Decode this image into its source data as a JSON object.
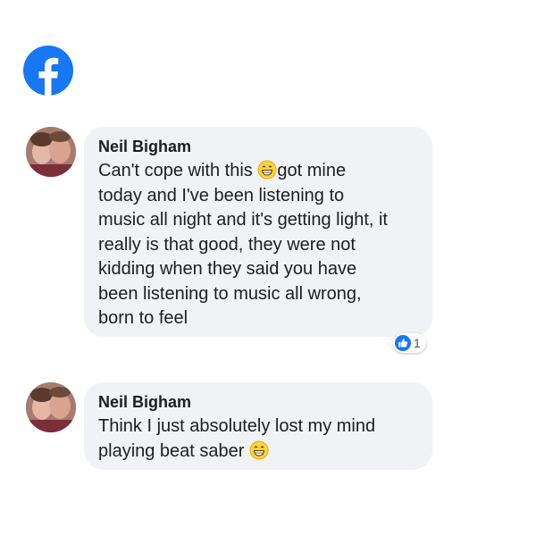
{
  "brand": {
    "logo_icon": "facebook-logo-icon",
    "color": "#1877f2"
  },
  "comments": [
    {
      "author": "Neil Bigham",
      "text_lines": [
        "Can't cope with this",
        "got mine",
        "today and I've been listening to",
        "music all night and it's getting light, it",
        "really is that good, they were not",
        "kidding when they said you have",
        "been listening to music all wrong,",
        "born to feel"
      ],
      "emoji": "grinning-face-icon",
      "reaction": {
        "icon": "like-icon",
        "count": "1"
      }
    },
    {
      "author": "Neil Bigham",
      "text_lines": [
        "Think I just absolutely lost my mind",
        "playing beat saber"
      ],
      "emoji": "grinning-face-icon"
    }
  ]
}
